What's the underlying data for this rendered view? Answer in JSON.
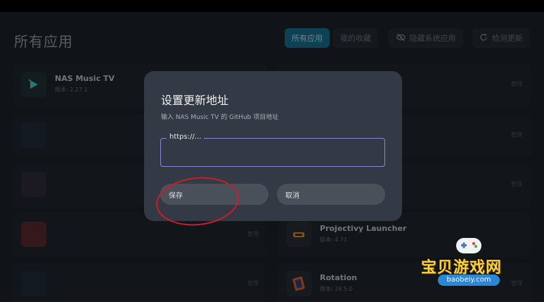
{
  "page": {
    "title": "所有应用",
    "tabs": [
      {
        "label": "所有应用",
        "active": true
      },
      {
        "label": "我的收藏",
        "active": false
      }
    ],
    "hide_system_label": "隐藏系统应用",
    "check_update_label": "检测更新"
  },
  "apps": [
    {
      "name": "NAS Music TV",
      "version": "版本: 2.17.1",
      "manage": "管理"
    },
    {
      "name": "",
      "version": "",
      "manage": "管理"
    },
    {
      "name": "",
      "version": "",
      "manage": "管理"
    },
    {
      "name": "",
      "version": "",
      "manage": "管理"
    },
    {
      "name": "Projectivy Launcher",
      "version": "版本: 4.71",
      "manage": ""
    },
    {
      "name": "",
      "version": "",
      "manage": "管理"
    },
    {
      "name": "Rotation",
      "version": "版本: 28.5.0",
      "manage": "管理"
    },
    {
      "name": "",
      "version": "",
      "manage": "管理"
    },
    {
      "name": "",
      "version": "",
      "manage": "管理"
    },
    {
      "name": "",
      "version": "",
      "manage": "管理"
    }
  ],
  "dialog": {
    "title": "设置更新地址",
    "subtitle": "输入 NAS Music TV 的 GitHub 项目地址",
    "field_label": "https://...",
    "field_value": "",
    "save_label": "保存",
    "cancel_label": "取消"
  },
  "watermark": {
    "title": "宝贝游戏网",
    "url": "baobeiy.com"
  },
  "colors": {
    "accent_tab": "#0f6f8e",
    "dialog_bg": "#343a45",
    "field_border": "#8f86d8",
    "annotation_red": "#c81e2a"
  }
}
